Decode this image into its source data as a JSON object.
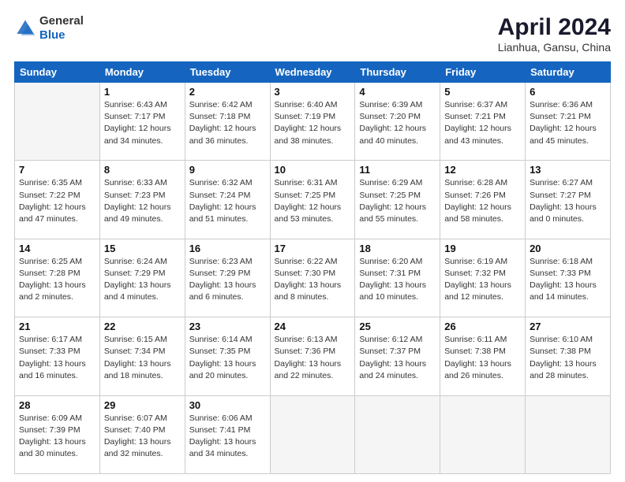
{
  "header": {
    "logo_general": "General",
    "logo_blue": "Blue",
    "title": "April 2024",
    "subtitle": "Lianhua, Gansu, China"
  },
  "days_of_week": [
    "Sunday",
    "Monday",
    "Tuesday",
    "Wednesday",
    "Thursday",
    "Friday",
    "Saturday"
  ],
  "weeks": [
    [
      {
        "day": "",
        "lines": []
      },
      {
        "day": "1",
        "lines": [
          "Sunrise: 6:43 AM",
          "Sunset: 7:17 PM",
          "Daylight: 12 hours",
          "and 34 minutes."
        ]
      },
      {
        "day": "2",
        "lines": [
          "Sunrise: 6:42 AM",
          "Sunset: 7:18 PM",
          "Daylight: 12 hours",
          "and 36 minutes."
        ]
      },
      {
        "day": "3",
        "lines": [
          "Sunrise: 6:40 AM",
          "Sunset: 7:19 PM",
          "Daylight: 12 hours",
          "and 38 minutes."
        ]
      },
      {
        "day": "4",
        "lines": [
          "Sunrise: 6:39 AM",
          "Sunset: 7:20 PM",
          "Daylight: 12 hours",
          "and 40 minutes."
        ]
      },
      {
        "day": "5",
        "lines": [
          "Sunrise: 6:37 AM",
          "Sunset: 7:21 PM",
          "Daylight: 12 hours",
          "and 43 minutes."
        ]
      },
      {
        "day": "6",
        "lines": [
          "Sunrise: 6:36 AM",
          "Sunset: 7:21 PM",
          "Daylight: 12 hours",
          "and 45 minutes."
        ]
      }
    ],
    [
      {
        "day": "7",
        "lines": [
          "Sunrise: 6:35 AM",
          "Sunset: 7:22 PM",
          "Daylight: 12 hours",
          "and 47 minutes."
        ]
      },
      {
        "day": "8",
        "lines": [
          "Sunrise: 6:33 AM",
          "Sunset: 7:23 PM",
          "Daylight: 12 hours",
          "and 49 minutes."
        ]
      },
      {
        "day": "9",
        "lines": [
          "Sunrise: 6:32 AM",
          "Sunset: 7:24 PM",
          "Daylight: 12 hours",
          "and 51 minutes."
        ]
      },
      {
        "day": "10",
        "lines": [
          "Sunrise: 6:31 AM",
          "Sunset: 7:25 PM",
          "Daylight: 12 hours",
          "and 53 minutes."
        ]
      },
      {
        "day": "11",
        "lines": [
          "Sunrise: 6:29 AM",
          "Sunset: 7:25 PM",
          "Daylight: 12 hours",
          "and 55 minutes."
        ]
      },
      {
        "day": "12",
        "lines": [
          "Sunrise: 6:28 AM",
          "Sunset: 7:26 PM",
          "Daylight: 12 hours",
          "and 58 minutes."
        ]
      },
      {
        "day": "13",
        "lines": [
          "Sunrise: 6:27 AM",
          "Sunset: 7:27 PM",
          "Daylight: 13 hours",
          "and 0 minutes."
        ]
      }
    ],
    [
      {
        "day": "14",
        "lines": [
          "Sunrise: 6:25 AM",
          "Sunset: 7:28 PM",
          "Daylight: 13 hours",
          "and 2 minutes."
        ]
      },
      {
        "day": "15",
        "lines": [
          "Sunrise: 6:24 AM",
          "Sunset: 7:29 PM",
          "Daylight: 13 hours",
          "and 4 minutes."
        ]
      },
      {
        "day": "16",
        "lines": [
          "Sunrise: 6:23 AM",
          "Sunset: 7:29 PM",
          "Daylight: 13 hours",
          "and 6 minutes."
        ]
      },
      {
        "day": "17",
        "lines": [
          "Sunrise: 6:22 AM",
          "Sunset: 7:30 PM",
          "Daylight: 13 hours",
          "and 8 minutes."
        ]
      },
      {
        "day": "18",
        "lines": [
          "Sunrise: 6:20 AM",
          "Sunset: 7:31 PM",
          "Daylight: 13 hours",
          "and 10 minutes."
        ]
      },
      {
        "day": "19",
        "lines": [
          "Sunrise: 6:19 AM",
          "Sunset: 7:32 PM",
          "Daylight: 13 hours",
          "and 12 minutes."
        ]
      },
      {
        "day": "20",
        "lines": [
          "Sunrise: 6:18 AM",
          "Sunset: 7:33 PM",
          "Daylight: 13 hours",
          "and 14 minutes."
        ]
      }
    ],
    [
      {
        "day": "21",
        "lines": [
          "Sunrise: 6:17 AM",
          "Sunset: 7:33 PM",
          "Daylight: 13 hours",
          "and 16 minutes."
        ]
      },
      {
        "day": "22",
        "lines": [
          "Sunrise: 6:15 AM",
          "Sunset: 7:34 PM",
          "Daylight: 13 hours",
          "and 18 minutes."
        ]
      },
      {
        "day": "23",
        "lines": [
          "Sunrise: 6:14 AM",
          "Sunset: 7:35 PM",
          "Daylight: 13 hours",
          "and 20 minutes."
        ]
      },
      {
        "day": "24",
        "lines": [
          "Sunrise: 6:13 AM",
          "Sunset: 7:36 PM",
          "Daylight: 13 hours",
          "and 22 minutes."
        ]
      },
      {
        "day": "25",
        "lines": [
          "Sunrise: 6:12 AM",
          "Sunset: 7:37 PM",
          "Daylight: 13 hours",
          "and 24 minutes."
        ]
      },
      {
        "day": "26",
        "lines": [
          "Sunrise: 6:11 AM",
          "Sunset: 7:38 PM",
          "Daylight: 13 hours",
          "and 26 minutes."
        ]
      },
      {
        "day": "27",
        "lines": [
          "Sunrise: 6:10 AM",
          "Sunset: 7:38 PM",
          "Daylight: 13 hours",
          "and 28 minutes."
        ]
      }
    ],
    [
      {
        "day": "28",
        "lines": [
          "Sunrise: 6:09 AM",
          "Sunset: 7:39 PM",
          "Daylight: 13 hours",
          "and 30 minutes."
        ]
      },
      {
        "day": "29",
        "lines": [
          "Sunrise: 6:07 AM",
          "Sunset: 7:40 PM",
          "Daylight: 13 hours",
          "and 32 minutes."
        ]
      },
      {
        "day": "30",
        "lines": [
          "Sunrise: 6:06 AM",
          "Sunset: 7:41 PM",
          "Daylight: 13 hours",
          "and 34 minutes."
        ]
      },
      {
        "day": "",
        "lines": []
      },
      {
        "day": "",
        "lines": []
      },
      {
        "day": "",
        "lines": []
      },
      {
        "day": "",
        "lines": []
      }
    ]
  ]
}
